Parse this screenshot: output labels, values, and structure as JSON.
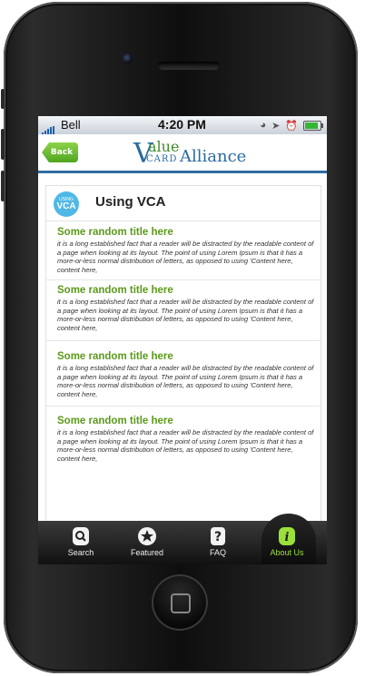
{
  "status": {
    "carrier": "Bell",
    "time": "4:20 PM"
  },
  "header": {
    "back_label": "Back",
    "logo": {
      "v": "V",
      "value": "alue",
      "card": "CARD",
      "alliance": "Alliance"
    }
  },
  "page": {
    "badge_small": "USING",
    "badge_big": "VCA",
    "title": "Using VCA"
  },
  "articles": [
    {
      "title": "Some random title here",
      "body": "it is a long established fact that a reader will be distracted by the readable content of a page when looking at its layout. The point of using Lorem Ipsum is that it has a more-or-less normal distribution of letters, as opposed to using 'Content here, content here,"
    },
    {
      "title": "Some random title here",
      "body": "it is a long established fact that a reader will be distracted by the readable content of a page when looking at its layout. The point of using Lorem Ipsum is that it has a more-or-less normal distribution of letters, as opposed to using 'Content here, content here,"
    },
    {
      "title": "Some random title here",
      "body": "it is a long established fact that a reader will be distracted by the readable content of a page when looking at its layout. The point of using Lorem Ipsum is that it has a more-or-less normal distribution of letters, as opposed to using 'Content here, content here,"
    },
    {
      "title": "Some random title here",
      "body": "it is a long established fact that a reader will be distracted by the readable content of a page when looking at its layout. The point of using Lorem Ipsum is that it has a more-or-less normal distribution of letters, as opposed to using 'Content here, content here,"
    }
  ],
  "tabs": [
    {
      "label": "Search",
      "icon": "search-icon"
    },
    {
      "label": "Featured",
      "icon": "star-icon"
    },
    {
      "label": "FAQ",
      "icon": "question-icon"
    },
    {
      "label": "About Us",
      "icon": "info-icon"
    }
  ],
  "colors": {
    "accent_green": "#5b9a1a",
    "active_tab": "#9be03a",
    "brand_blue": "#2a6aa0",
    "badge_blue": "#4fb8e6"
  }
}
